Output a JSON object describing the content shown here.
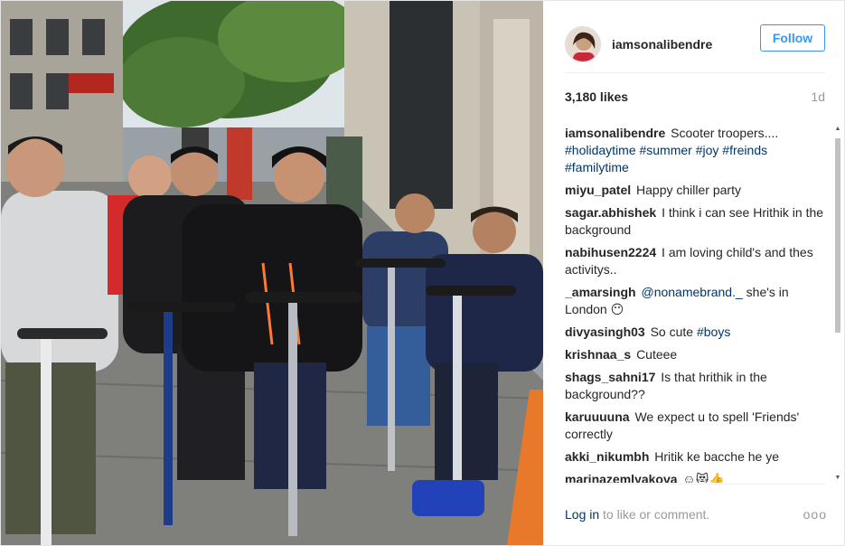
{
  "post": {
    "username": "iamsonalibendre",
    "follow_label": "Follow",
    "likes": "3,180 likes",
    "time": "1d"
  },
  "comments": [
    {
      "user": "iamsonalibendre",
      "text": "Scooter troopers....",
      "tags": "#holidaytime #summer #joy #freinds #familytime"
    },
    {
      "user": "miyu_patel",
      "text": "Happy chiller party"
    },
    {
      "user": "sagar.abhishek",
      "text": "I think i can see Hrithik in the background"
    },
    {
      "user": "nabihusen2224",
      "text": "I am loving child's and thes activitys.."
    },
    {
      "user": "_amarsingh",
      "mention": "@nonamebrand._",
      "text": "she's in London 😶"
    },
    {
      "user": "divyasingh03",
      "text": "So cute",
      "tags": "#boys"
    },
    {
      "user": "krishnaa_s",
      "text": "Cuteee"
    },
    {
      "user": "shags_sahni17",
      "text": "Is that hrithik in the background??"
    },
    {
      "user": "karuuuuna",
      "text": "We expect u to spell 'Friends' correctly"
    },
    {
      "user": "akki_nikumbh",
      "text": "Hritik ke bacche he ye"
    },
    {
      "user": "marinazemlyakova",
      "text": "☺😻👍"
    }
  ],
  "footer": {
    "login_link": "Log in",
    "login_text": " to like or comment.",
    "more_icon": "ooo"
  },
  "icons": {
    "more": "more-options-icon",
    "scroll_up": "scroll-up-icon",
    "scroll_down": "scroll-down-icon"
  },
  "colors": {
    "link": "#003569",
    "follow": "#3897f0",
    "muted": "#999999"
  }
}
